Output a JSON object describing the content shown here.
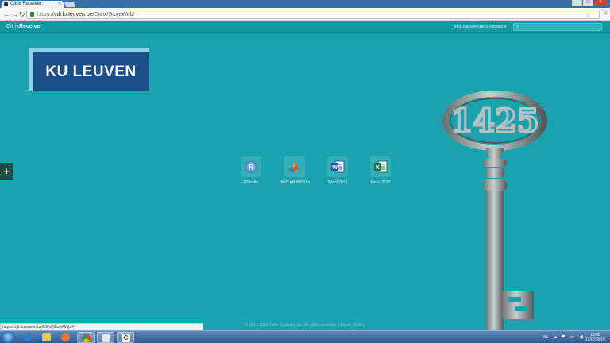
{
  "browser": {
    "tab_title": "Citrix Receiver",
    "tab_close": "×",
    "url_scheme": "https://",
    "url_host": "vdi.kuleuven.be",
    "url_path": "/Citrix/StoreWeb/",
    "back_icon": "arrow-left-icon",
    "forward_icon": "arrow-right-icon",
    "reload_icon": "reload-icon"
  },
  "citrix": {
    "brand_prefix": "Citrix",
    "brand_name": "Receiver",
    "user_label": "luna.kuleuven.be\\u0088885 ▾",
    "search_placeholder": ""
  },
  "logo": {
    "text": "KU LEUVEN"
  },
  "add_button": {
    "label": "+"
  },
  "apps": [
    {
      "name": "RStudio",
      "icon": "rstudio-icon",
      "color": "#4a86c8"
    },
    {
      "name": "MATLAB R2015a",
      "icon": "matlab-icon",
      "color": "#d9532b"
    },
    {
      "name": "Word 2013",
      "icon": "word-icon",
      "color": "#2b579a"
    },
    {
      "name": "Excel 2013",
      "icon": "excel-icon",
      "color": "#217346"
    }
  ],
  "key_art": {
    "number": "1425"
  },
  "footer": {
    "text": "© 2017-2016 Citrix Systems, Inc. All rights reserved. | Privacy Policy"
  },
  "status_bar": {
    "url": "https://vdi.kuleuven.be/Citrix/StoreWeb/#"
  },
  "taskbar": {
    "language": "NL",
    "time": "13:45",
    "date": "12/07/2016",
    "tray_icons": "▴ ⚑ ▭ ◀)"
  },
  "colors": {
    "background": "#1aa3ae",
    "header": "#1797a2",
    "logo_blue": "#1d4e86",
    "logo_frame": "#8ad2e8"
  }
}
